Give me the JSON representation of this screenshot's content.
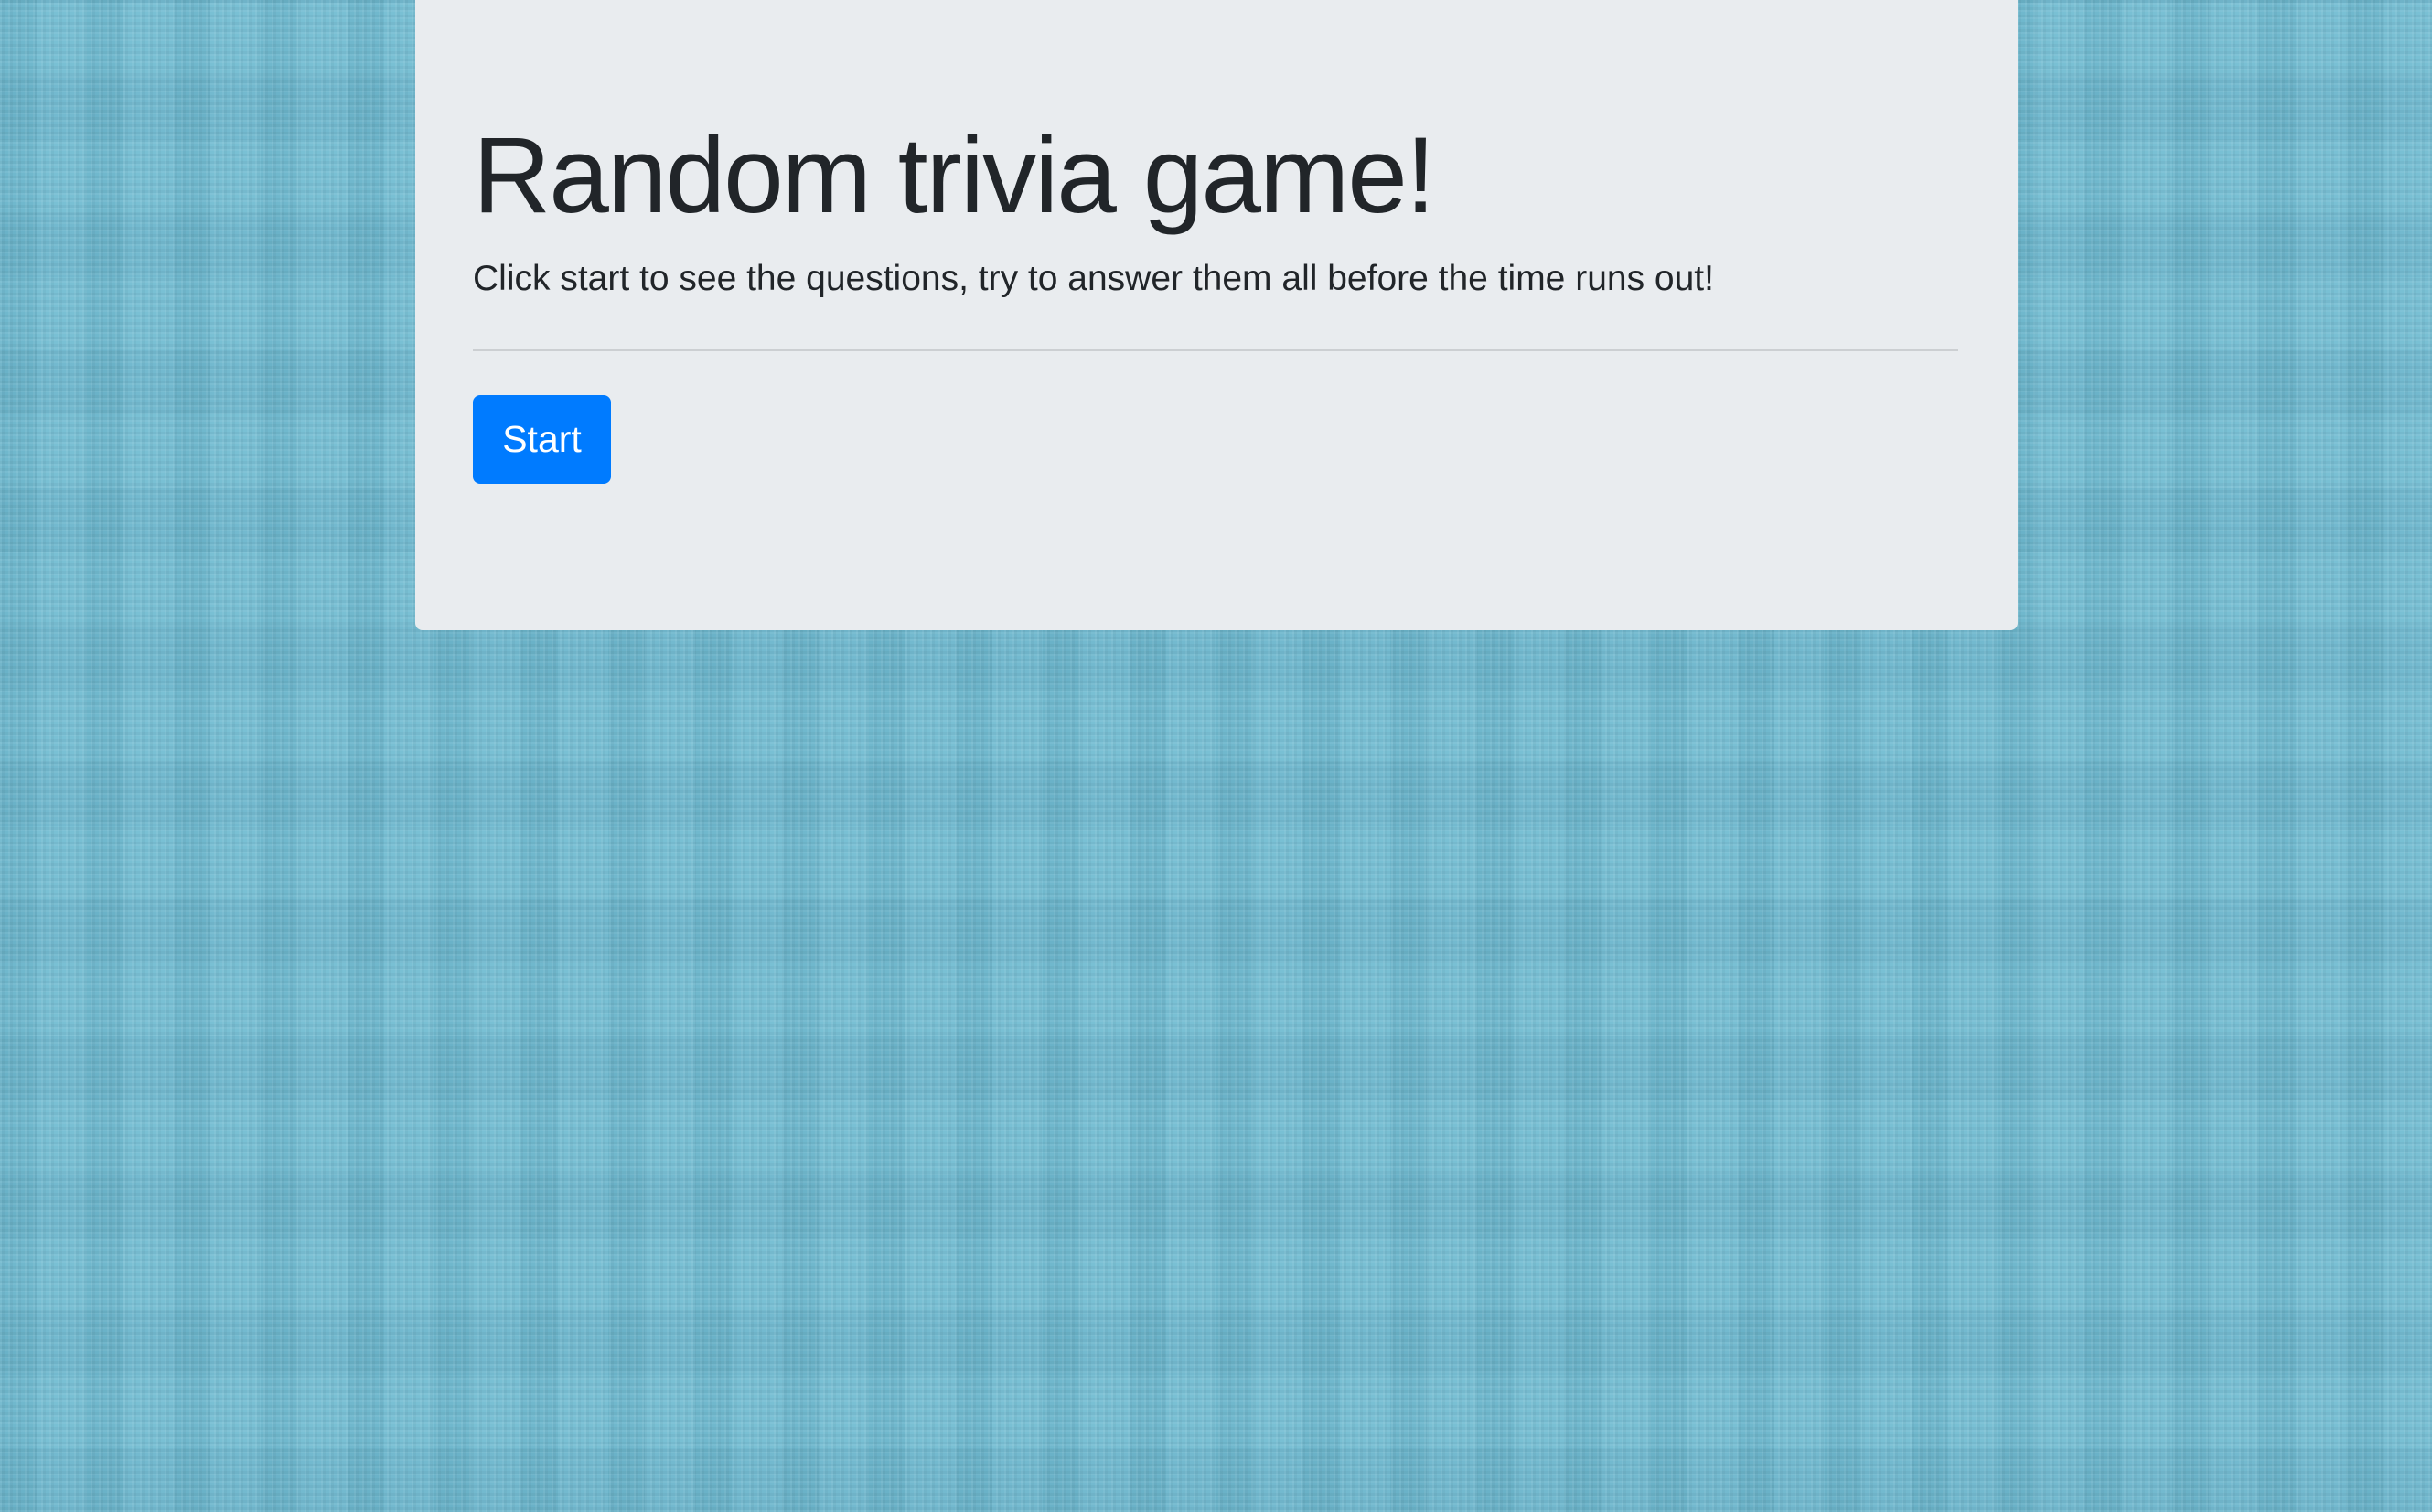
{
  "jumbotron": {
    "title": "Random trivia game!",
    "lead": "Click start to see the questions, try to answer them all before the time runs out!",
    "start_label": "Start"
  },
  "colors": {
    "background": "#72bcd2",
    "panel": "#e9ecef",
    "primary_button": "#007bff",
    "text": "#212529"
  }
}
